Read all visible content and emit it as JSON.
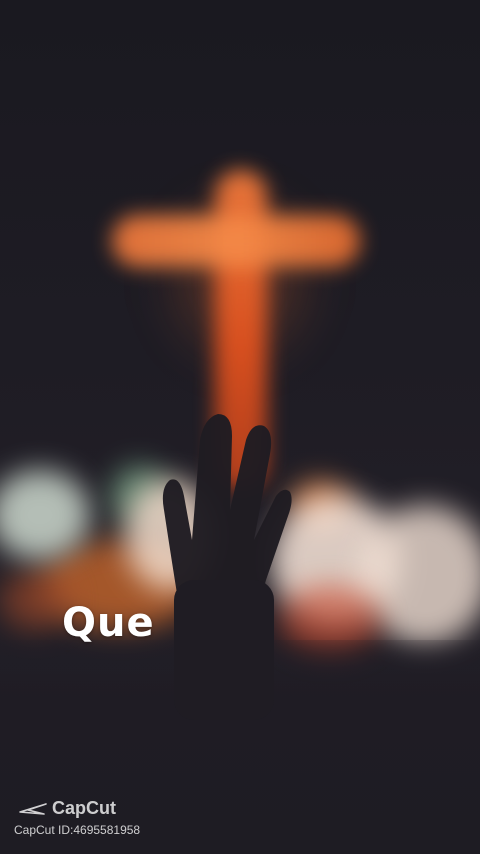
{
  "overlay": {
    "caption": "Que"
  },
  "watermark": {
    "brand": "CapCut",
    "id_text": "CapCut ID:4695581958",
    "logo_icon": "capcut-logo-icon"
  },
  "scene": {
    "cross_color": "#e8622a",
    "background_color": "#1c1a22"
  }
}
